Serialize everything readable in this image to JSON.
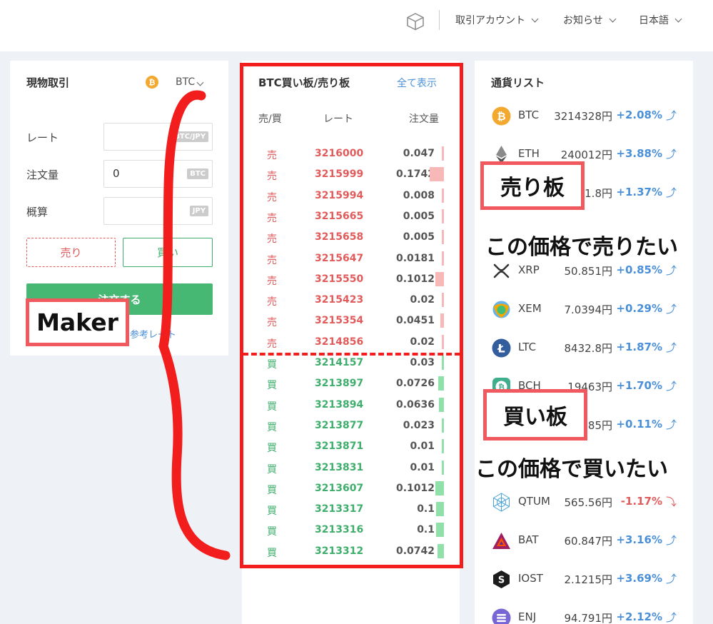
{
  "topbar": {
    "account": "取引アカウント",
    "news": "お知らせ",
    "language": "日本語"
  },
  "spot": {
    "title": "現物取引",
    "coin": "BTC",
    "coin_icon": "bitcoin-icon",
    "rate_label": "レート",
    "rate_unit": "BTC/JPY",
    "qty_label": "注文量",
    "qty_value": "0",
    "qty_unit": "BTC",
    "est_label": "概算",
    "est_unit": "JPY",
    "sell": "売り",
    "buy": "買い",
    "order": "注文する",
    "ref": "参考レート"
  },
  "orderbook": {
    "title": "BTC買い板/売り板",
    "show_all": "全て表示",
    "headers": {
      "side": "売/買",
      "rate": "レート",
      "qty": "注文量"
    },
    "asks": [
      {
        "side": "売",
        "rate": "3216000",
        "qty": "0.047",
        "bar": 0.03
      },
      {
        "side": "売",
        "rate": "3215999",
        "qty": "0.1742",
        "bar": 0.1742
      },
      {
        "side": "売",
        "rate": "3215994",
        "qty": "0.008",
        "bar": 0.008
      },
      {
        "side": "売",
        "rate": "3215665",
        "qty": "0.005",
        "bar": 0.005
      },
      {
        "side": "売",
        "rate": "3215658",
        "qty": "0.005",
        "bar": 0.005
      },
      {
        "side": "売",
        "rate": "3215647",
        "qty": "0.0181",
        "bar": 0.0181
      },
      {
        "side": "売",
        "rate": "3215550",
        "qty": "0.1012",
        "bar": 0.1012
      },
      {
        "side": "売",
        "rate": "3215423",
        "qty": "0.02",
        "bar": 0.02
      },
      {
        "side": "売",
        "rate": "3215354",
        "qty": "0.0451",
        "bar": 0.0451
      },
      {
        "side": "売",
        "rate": "3214856",
        "qty": "0.02",
        "bar": 0.02
      }
    ],
    "bids": [
      {
        "side": "買",
        "rate": "3214157",
        "qty": "0.03",
        "bar": 0.03
      },
      {
        "side": "買",
        "rate": "3213897",
        "qty": "0.0726",
        "bar": 0.0726
      },
      {
        "side": "買",
        "rate": "3213894",
        "qty": "0.0636",
        "bar": 0.0636
      },
      {
        "side": "買",
        "rate": "3213877",
        "qty": "0.023",
        "bar": 0.023
      },
      {
        "side": "買",
        "rate": "3213871",
        "qty": "0.01",
        "bar": 0.01
      },
      {
        "side": "買",
        "rate": "3213831",
        "qty": "0.01",
        "bar": 0.01
      },
      {
        "side": "買",
        "rate": "3213607",
        "qty": "0.1012",
        "bar": 0.1012
      },
      {
        "side": "買",
        "rate": "3213317",
        "qty": "0.1",
        "bar": 0.1
      },
      {
        "side": "買",
        "rate": "3213316",
        "qty": "0.1",
        "bar": 0.1
      },
      {
        "side": "買",
        "rate": "3213312",
        "qty": "0.0742",
        "bar": 0.0742
      }
    ]
  },
  "currency_list": {
    "title": "通貨リスト",
    "items": [
      {
        "symbol": "BTC",
        "price": "3214328円",
        "change": "+2.08%",
        "dir": "up",
        "icon": "bitcoin-icon"
      },
      {
        "symbol": "ETH",
        "price": "240012円",
        "change": "+3.88%",
        "dir": "up",
        "icon": "ethereum-icon"
      },
      {
        "symbol": "",
        "price": "1.8円",
        "change": "+1.37%",
        "dir": "up",
        "icon": ""
      },
      {
        "symbol": "XRP",
        "price": "50.851円",
        "change": "+0.85%",
        "dir": "up",
        "icon": "ripple-icon"
      },
      {
        "symbol": "XEM",
        "price": "7.0394円",
        "change": "+0.29%",
        "dir": "up",
        "icon": "nem-icon"
      },
      {
        "symbol": "LTC",
        "price": "8432.8円",
        "change": "+1.87%",
        "dir": "up",
        "icon": "litecoin-icon"
      },
      {
        "symbol": "BCH",
        "price": "19463円",
        "change": "+1.70%",
        "dir": "up",
        "icon": "bitcoin-cash-icon"
      },
      {
        "symbol": "",
        "price": "585円",
        "change": "+0.11%",
        "dir": "up",
        "icon": ""
      },
      {
        "symbol": "QTUM",
        "price": "565.56円",
        "change": "-1.17%",
        "dir": "down",
        "icon": "qtum-icon"
      },
      {
        "symbol": "BAT",
        "price": "60.847円",
        "change": "+3.16%",
        "dir": "up",
        "icon": "bat-icon"
      },
      {
        "symbol": "IOST",
        "price": "2.1215円",
        "change": "+3.69%",
        "dir": "up",
        "icon": "iost-icon"
      },
      {
        "symbol": "ENJ",
        "price": "94.791円",
        "change": "+2.12%",
        "dir": "up",
        "icon": "enjin-icon"
      }
    ]
  },
  "annotations": {
    "maker": "Maker",
    "sell_board": "売り板",
    "sell_note": "この価格で売りたい",
    "buy_board": "買い板",
    "buy_note": "この価格で買いたい"
  },
  "colors": {
    "ask": "#e15b5b",
    "bid": "#3fae6c",
    "accent": "#4a90d9",
    "order_button": "#47b873",
    "annotation_red": "#f21d1d"
  }
}
